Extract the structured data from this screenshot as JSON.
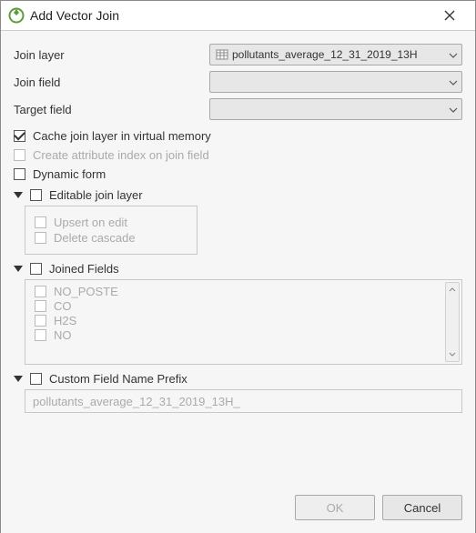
{
  "window": {
    "title": "Add Vector Join"
  },
  "form": {
    "join_layer_label": "Join layer",
    "join_layer_value": "pollutants_average_12_31_2019_13H",
    "join_field_label": "Join field",
    "join_field_value": "",
    "target_field_label": "Target field",
    "target_field_value": ""
  },
  "checks": {
    "cache_label": "Cache join layer in virtual memory",
    "cache_checked": true,
    "create_index_label": "Create attribute index on join field",
    "dynamic_form_label": "Dynamic form"
  },
  "editable": {
    "section_label": "Editable join layer",
    "upsert_label": "Upsert on edit",
    "delete_label": "Delete cascade"
  },
  "joined": {
    "section_label": "Joined Fields",
    "fields": [
      "NO_POSTE",
      "CO",
      "H2S",
      "NO"
    ]
  },
  "prefix": {
    "section_label": "Custom Field Name Prefix",
    "value": "pollutants_average_12_31_2019_13H_"
  },
  "buttons": {
    "ok": "OK",
    "cancel": "Cancel"
  }
}
